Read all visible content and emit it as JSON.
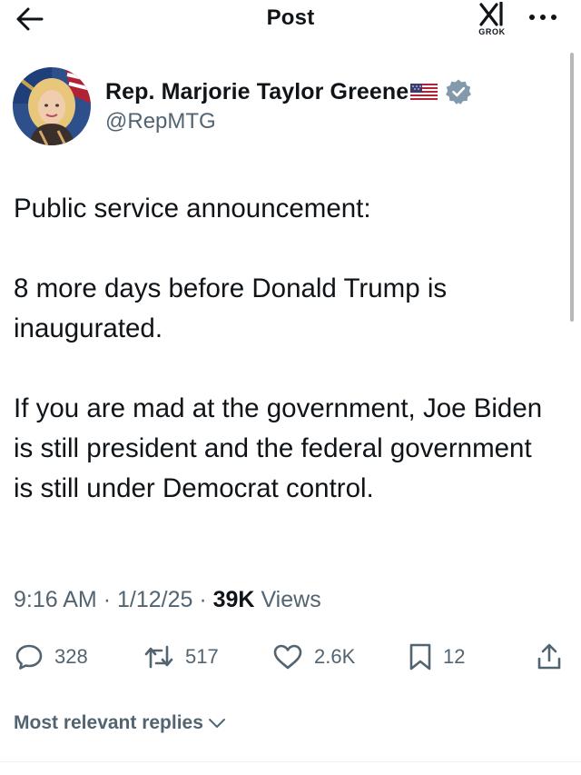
{
  "header": {
    "title": "Post",
    "grok_label": "GROK"
  },
  "author": {
    "name": "Rep. Marjorie Taylor Greene",
    "handle": "@RepMTG",
    "flag": "us-flag-emoji",
    "verified_icon": "verified-badge-icon"
  },
  "tweet": {
    "paragraphs": [
      "Public service announcement:",
      "8 more days before Donald Trump is inaugurated.",
      "If you are mad at the government, Joe Biden is still president and the federal government is still under Democrat control."
    ]
  },
  "meta": {
    "time": "9:16 AM",
    "date": "1/12/25",
    "views_count": "39K",
    "views_label": "Views",
    "separator": "·"
  },
  "actions": {
    "replies": "328",
    "reposts": "517",
    "likes": "2.6K",
    "bookmarks": "12"
  },
  "replies_sort": {
    "label": "Most relevant replies"
  },
  "colors": {
    "text": "#0f1419",
    "secondary": "#536471",
    "verified": "#829aab",
    "background": "#ffffff"
  }
}
